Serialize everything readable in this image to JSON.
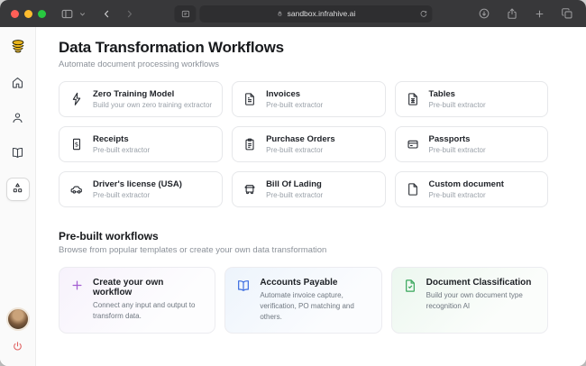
{
  "browser": {
    "url": "sandbox.infrahive.ai",
    "colors": {
      "traffic_close": "#ff5f57",
      "traffic_minimize": "#febc2e",
      "traffic_zoom": "#28c840",
      "chrome_bg": "#38383a"
    }
  },
  "brand": {
    "logo_color": "#e8b41c"
  },
  "page": {
    "title": "Data Transformation Workflows",
    "subtitle": "Automate document processing workflows"
  },
  "extractors": [
    {
      "icon": "zap-icon",
      "title": "Zero Training Model",
      "subtitle": "Build your own zero training extractor"
    },
    {
      "icon": "invoice-file-icon",
      "title": "Invoices",
      "subtitle": "Pre-built extractor"
    },
    {
      "icon": "table-file-icon",
      "title": "Tables",
      "subtitle": "Pre-built extractor"
    },
    {
      "icon": "receipt-icon",
      "title": "Receipts",
      "subtitle": "Pre-built extractor"
    },
    {
      "icon": "clipboard-icon",
      "title": "Purchase Orders",
      "subtitle": "Pre-built extractor"
    },
    {
      "icon": "passport-card-icon",
      "title": "Passports",
      "subtitle": "Pre-built extractor"
    },
    {
      "icon": "car-icon",
      "title": "Driver's license (USA)",
      "subtitle": "Pre-built extractor"
    },
    {
      "icon": "truck-icon",
      "title": "Bill Of Lading",
      "subtitle": "Pre-built extractor"
    },
    {
      "icon": "blank-file-icon",
      "title": "Custom document",
      "subtitle": "Pre-built extractor"
    }
  ],
  "workflows": {
    "title": "Pre-built workflows",
    "subtitle": "Browse from popular templates or create your own data transformation",
    "cards": [
      {
        "icon": "plus-icon",
        "accent": "#a35ed1",
        "title": "Create your own workflow",
        "description": "Connect any input and output to transform data."
      },
      {
        "icon": "book-open-icon",
        "accent": "#3b6ce0",
        "title": "Accounts Payable",
        "description": "Automate invoice capture, verification, PO matching and others."
      },
      {
        "icon": "file-check-icon",
        "accent": "#37a65a",
        "title": "Document Classification",
        "description": "Build your own document type recognition AI"
      }
    ]
  }
}
